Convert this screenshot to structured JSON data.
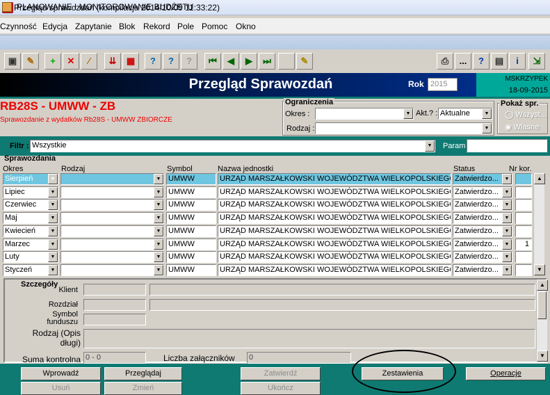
{
  "app": {
    "title": "PLANOWANIE I MONITOROWANIE BUDŻETU"
  },
  "menu": [
    "Czynność",
    "Edycja",
    "Zapytanie",
    "Blok",
    "Rekord",
    "Pole",
    "Pomoc",
    "Okno"
  ],
  "window": {
    "caption": "Przegląd sprawozdań (kompilacja 2014/10/09 11:33:22)"
  },
  "toolbar": {
    "icons": [
      "save-icon",
      "edit-icon",
      "add-icon",
      "delete-icon",
      "wand-icon",
      "import-icon",
      "grid-icon",
      "query-icon",
      "run-query-icon",
      "cancel-query-icon",
      "first-icon",
      "prev-icon",
      "next-icon",
      "last-icon",
      "blank-icon",
      "note-icon",
      "printer-icon",
      "more-icon",
      "help-icon",
      "calc-icon",
      "info-icon",
      "exit-icon"
    ],
    "more_label": "..."
  },
  "header": {
    "title": "Przegląd Sprawozdań",
    "rok_label": "Rok",
    "rok_value": "2015",
    "user": "MSKRZYPEK",
    "date": "18-09-2015"
  },
  "report": {
    "code": "RB28S - UMWW - ZB",
    "description": "Sprawozdanie z wydatków Rb28S - UMWW ZBIORCZE"
  },
  "ograniczenia": {
    "title": "Ograniczenia",
    "okres_label": "Okres :",
    "okres_value": "",
    "akt_label": "Akt.? :",
    "akt_value": "Aktualne",
    "rodzaj_label": "Rodzaj :",
    "rodzaj_value": ""
  },
  "pokaz": {
    "title": "Pokaż spr.",
    "option_all": "Wszyst...",
    "option_own": "Własne"
  },
  "filter": {
    "label": "Filtr :",
    "value": "Wszystkie",
    "param_label": "Param",
    "param_value": ""
  },
  "section": {
    "title": "Sprawozdania",
    "columns": {
      "okres": "Okres",
      "rodzaj": "Rodzaj",
      "symbol": "Symbol",
      "nazwa": "Nazwa jednostki",
      "status": "Status",
      "nr": "Nr kor."
    }
  },
  "rows": [
    {
      "okres": "Sierpień",
      "rodzaj": "",
      "symbol": "UMWW",
      "nazwa": "URZĄD MARSZAŁKOWSKI WOJEWÓDZTWA WIELKOPOLSKIEGO W",
      "status": "Zatwierdzo...",
      "nr": ""
    },
    {
      "okres": "Lipiec",
      "rodzaj": "",
      "symbol": "UMWW",
      "nazwa": "URZĄD MARSZAŁKOWSKI WOJEWÓDZTWA WIELKOPOLSKIEGO W",
      "status": "Zatwierdzo...",
      "nr": ""
    },
    {
      "okres": "Czerwiec",
      "rodzaj": "",
      "symbol": "UMWW",
      "nazwa": "URZĄD MARSZAŁKOWSKI WOJEWÓDZTWA WIELKOPOLSKIEGO W",
      "status": "Zatwierdzo...",
      "nr": ""
    },
    {
      "okres": "Maj",
      "rodzaj": "",
      "symbol": "UMWW",
      "nazwa": "URZĄD MARSZAŁKOWSKI WOJEWÓDZTWA WIELKOPOLSKIEGO W",
      "status": "Zatwierdzo...",
      "nr": ""
    },
    {
      "okres": "Kwiecień",
      "rodzaj": "",
      "symbol": "UMWW",
      "nazwa": "URZĄD MARSZAŁKOWSKI WOJEWÓDZTWA WIELKOPOLSKIEGO W",
      "status": "Zatwierdzo...",
      "nr": ""
    },
    {
      "okres": "Marzec",
      "rodzaj": "",
      "symbol": "UMWW",
      "nazwa": "URZĄD MARSZAŁKOWSKI WOJEWÓDZTWA WIELKOPOLSKIEGO W",
      "status": "Zatwierdzo...",
      "nr": "1"
    },
    {
      "okres": "Luty",
      "rodzaj": "",
      "symbol": "UMWW",
      "nazwa": "URZĄD MARSZAŁKOWSKI WOJEWÓDZTWA WIELKOPOLSKIEGO W",
      "status": "Zatwierdzo...",
      "nr": ""
    },
    {
      "okres": "Styczeń",
      "rodzaj": "",
      "symbol": "UMWW",
      "nazwa": "URZĄD MARSZAŁKOWSKI WOJEWÓDZTWA WIELKOPOLSKIEGO W",
      "status": "Zatwierdzo...",
      "nr": ""
    }
  ],
  "details": {
    "title": "Szczegóły",
    "klient_label": "Klient",
    "rozdzial_label": "Rozdział",
    "symbol_label": "Symbol funduszu",
    "rodzaj_label": "Rodzaj (Opis długi)",
    "suma_label": "Suma kontrolna",
    "suma_value": "0 - 0",
    "zal_label": "Liczba załączników",
    "zal_value": "0"
  },
  "buttons": {
    "wprowadz": "Wprowadź",
    "przegladaj": "Przeglądaj",
    "zatwierdz": "Zatwierdź",
    "zestawienia": "Zestawienia",
    "operacje": "Operacje",
    "usun": "Usuń",
    "zmien": "Zmień",
    "ukoncz": "Ukończ"
  },
  "colors": {
    "header_blue": "#003399",
    "teal": "#0f7a72",
    "accent_red": "#e00000",
    "user_teal": "#00a89a"
  }
}
